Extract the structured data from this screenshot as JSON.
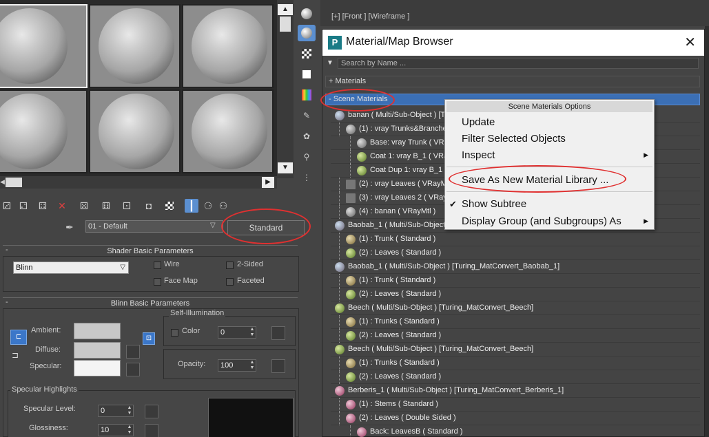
{
  "viewport": {
    "label": "[+] [Front ] [Wireframe ]"
  },
  "material_editor": {
    "material_name": "01 - Default",
    "material_type": "Standard",
    "shader_rollout": {
      "title": "Shader Basic Parameters",
      "shader": "Blinn",
      "wire": "Wire",
      "two_sided": "2-Sided",
      "face_map": "Face Map",
      "faceted": "Faceted"
    },
    "blinn_rollout": {
      "title": "Blinn Basic Parameters",
      "self_illum_title": "Self-Illumination",
      "ambient": "Ambient:",
      "diffuse": "Diffuse:",
      "specular": "Specular:",
      "color_label": "Color",
      "color_value": "0",
      "opacity_label": "Opacity:",
      "opacity_value": "100",
      "spec_title": "Specular Highlights",
      "spec_level_label": "Specular Level:",
      "spec_level_value": "0",
      "glossiness_label": "Glossiness:",
      "glossiness_value": "10"
    }
  },
  "browser": {
    "title": "Material/Map Browser",
    "search_placeholder": "Search by Name ...",
    "cat_materials": "+ Materials",
    "cat_scene": "- Scene Materials"
  },
  "tree_rows": [
    {
      "text": "banan  ( Multi/Sub-Object ) [Turing_MatConvert_banan]",
      "indent": 0,
      "ball": "multi"
    },
    {
      "text": "(1) : vray Trunks&Branches  ( VRayMtl )",
      "indent": 1,
      "ball": "grey"
    },
    {
      "text": "Base: vray Trunk  ( VRayMtl )",
      "indent": 2,
      "ball": "grey"
    },
    {
      "text": "Coat 1: vray B_1  ( VRayMtl )",
      "indent": 2,
      "ball": "green"
    },
    {
      "text": "Coat Dup 1: vray B_1  ( VRayMtl )",
      "indent": 2,
      "ball": "green"
    },
    {
      "text": "(2) : vray Leaves  ( VRayMtl )",
      "indent": 1,
      "ball": "sq"
    },
    {
      "text": "(3) : vray Leaves 2  ( VRayMtl )",
      "indent": 1,
      "ball": "sq"
    },
    {
      "text": "(4) : banan  ( VRayMtl )",
      "indent": 1,
      "ball": "grey"
    },
    {
      "text": "Baobab_1  ( Multi/Sub-Object ) [Turing_MatConvert_Baobab_1]",
      "indent": 0,
      "ball": "multi"
    },
    {
      "text": "(1) : Trunk  ( Standard )",
      "indent": 1,
      "ball": "tan"
    },
    {
      "text": "(2) : Leaves  ( Standard )",
      "indent": 1,
      "ball": "green"
    },
    {
      "text": "Baobab_1  ( Multi/Sub-Object ) [Turing_MatConvert_Baobab_1]",
      "indent": 0,
      "ball": "multi"
    },
    {
      "text": "(1) : Trunk  ( Standard )",
      "indent": 1,
      "ball": "tan"
    },
    {
      "text": "(2) : Leaves  ( Standard )",
      "indent": 1,
      "ball": "green"
    },
    {
      "text": "Beech  ( Multi/Sub-Object ) [Turing_MatConvert_Beech]",
      "indent": 0,
      "ball": "green"
    },
    {
      "text": "(1) : Trunks  ( Standard )",
      "indent": 1,
      "ball": "tan"
    },
    {
      "text": "(2) : Leaves  ( Standard )",
      "indent": 1,
      "ball": "green"
    },
    {
      "text": "Beech  ( Multi/Sub-Object ) [Turing_MatConvert_Beech]",
      "indent": 0,
      "ball": "green"
    },
    {
      "text": "(1) : Trunks  ( Standard )",
      "indent": 1,
      "ball": "tan"
    },
    {
      "text": "(2) : Leaves  ( Standard )",
      "indent": 1,
      "ball": "green"
    },
    {
      "text": "Berberis_1  ( Multi/Sub-Object ) [Turing_MatConvert_Berberis_1]",
      "indent": 0,
      "ball": "pink"
    },
    {
      "text": "(1) : Stems  ( Standard )",
      "indent": 1,
      "ball": "pink"
    },
    {
      "text": "(2) : Leaves  ( Double Sided )",
      "indent": 1,
      "ball": "pink"
    },
    {
      "text": "Back: LeavesB  ( Standard )",
      "indent": 2,
      "ball": "pink"
    }
  ],
  "context_menu": {
    "header": "Scene Materials Options",
    "update": "Update",
    "filter": "Filter Selected Objects",
    "inspect": "Inspect",
    "save_as": "Save As New Material Library ...",
    "show_subtree": "Show Subtree",
    "display_group": "Display Group (and Subgroups) As",
    "check_mark": "✔",
    "submenu_arrow": "▶"
  },
  "colors": {
    "highlight_ellipse": "#e03030",
    "selection_blue": "#3b6fb5"
  }
}
